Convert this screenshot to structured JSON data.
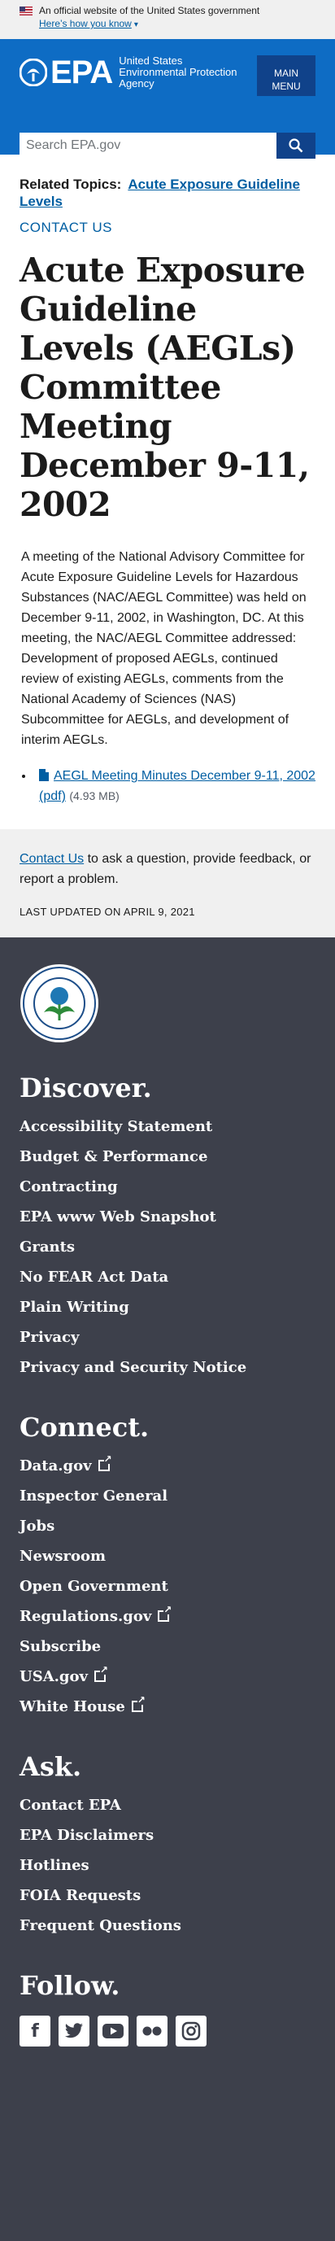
{
  "gov_banner": {
    "text": "An official website of the United States government",
    "link": "Here’s how you know"
  },
  "header": {
    "logo_text": "EPA",
    "agency_name": "United States Environmental Protection Agency",
    "menu_label_1": "MAIN",
    "menu_label_2": "MENU",
    "search_placeholder": "Search EPA.gov"
  },
  "main": {
    "related_label": "Related Topics:",
    "related_link": "Acute Exposure Guideline Levels",
    "contact_us": "CONTACT US",
    "title": "Acute Exposure Guideline Levels (AEGLs) Committee Meeting December 9-11, 2002",
    "body": "A meeting of the National Advisory Committee for Acute Exposure Guideline Levels for Hazardous Substances (NAC/AEGL Committee) was held on December 9-11, 2002, in Washington, DC. At this meeting, the NAC/AEGL Committee addressed: Development of proposed AEGLs, continued review of existing AEGLs, comments from the National Academy of Sciences (NAS) Subcommittee for AEGLs, and development of interim AEGLs.",
    "file_link": "AEGL Meeting Minutes December 9-11, 2002 (pdf)",
    "file_size": "(4.93 MB)"
  },
  "feedback": {
    "link": "Contact Us",
    "text": " to ask a question, provide feedback, or report a problem.",
    "updated": "LAST UPDATED ON APRIL 9, 2021"
  },
  "footer": {
    "discover": {
      "heading": "Discover.",
      "items": [
        "Accessibility Statement",
        "Budget & Performance",
        "Contracting",
        "EPA www Web Snapshot",
        "Grants",
        "No FEAR Act Data",
        "Plain Writing",
        "Privacy",
        "Privacy and Security Notice"
      ]
    },
    "connect": {
      "heading": "Connect.",
      "items": [
        "Data.gov",
        "Inspector General",
        "Jobs",
        "Newsroom",
        "Open Government",
        "Regulations.gov",
        "Subscribe",
        "USA.gov",
        "White House"
      ]
    },
    "ask": {
      "heading": "Ask.",
      "items": [
        "Contact EPA",
        "EPA Disclaimers",
        "Hotlines",
        "FOIA Requests",
        "Frequent Questions"
      ]
    },
    "follow": {
      "heading": "Follow.",
      "icons": [
        "facebook-icon",
        "twitter-icon",
        "youtube-icon",
        "flickr-icon",
        "instagram-icon"
      ]
    }
  },
  "colors": {
    "header_blue": "#0e6cc4",
    "dark_blue": "#10428a",
    "link_blue": "#005ea2",
    "footer_bg": "#3d404b"
  }
}
